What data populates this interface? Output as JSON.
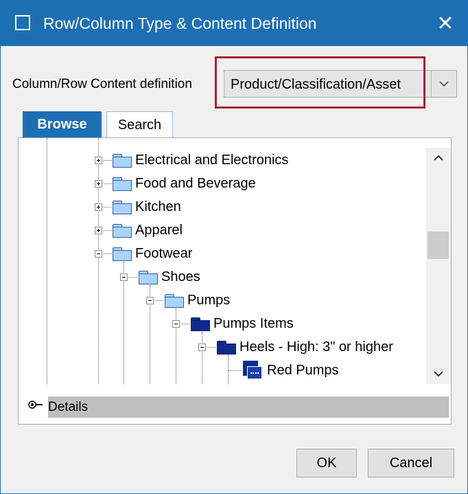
{
  "window": {
    "title": "Row/Column Type & Content Definition",
    "close_glyph": "✕"
  },
  "content_definition": {
    "label": "Column/Row Content definition",
    "selected_value": "Product/Classification/Asset"
  },
  "tabs": [
    {
      "label": "Browse",
      "active": true
    },
    {
      "label": "Search",
      "active": false
    }
  ],
  "tree": {
    "nodes": [
      {
        "label": "Electrical and Electronics",
        "expander": "plus",
        "icon": "folder-light"
      },
      {
        "label": "Food and Beverage",
        "expander": "plus",
        "icon": "folder-light"
      },
      {
        "label": "Kitchen",
        "expander": "plus",
        "icon": "folder-light"
      },
      {
        "label": "Apparel",
        "expander": "plus",
        "icon": "folder-light"
      },
      {
        "label": "Footwear",
        "expander": "minus",
        "icon": "folder-light"
      },
      {
        "label": "Shoes",
        "expander": "minus",
        "icon": "folder-light"
      },
      {
        "label": "Pumps",
        "expander": "minus",
        "icon": "folder-light"
      },
      {
        "label": "Pumps Items",
        "expander": "minus",
        "icon": "folder-dark"
      },
      {
        "label": "Heels - High: 3\" or higher",
        "expander": "minus",
        "icon": "folder-dark"
      },
      {
        "label": "Red Pumps",
        "expander": "none",
        "icon": "asset-icon"
      }
    ]
  },
  "details": {
    "label": "Details"
  },
  "buttons": {
    "ok": "OK",
    "cancel": "Cancel"
  },
  "colors": {
    "accent": "#1d6fb4",
    "highlight_border": "#a3222f",
    "folder_light": "#a7d4f7",
    "folder_dark": "#0d2a8f"
  }
}
